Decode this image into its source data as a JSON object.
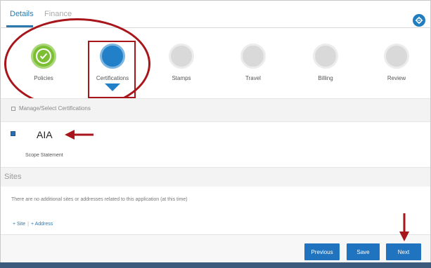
{
  "tabs": {
    "details": "Details",
    "finance": "Finance"
  },
  "steps": [
    {
      "label": "Policies",
      "state": "complete"
    },
    {
      "label": "Certifications",
      "state": "current"
    },
    {
      "label": "Stamps",
      "state": "pending"
    },
    {
      "label": "Travel",
      "state": "pending"
    },
    {
      "label": "Billing",
      "state": "pending"
    },
    {
      "label": "Review",
      "state": "pending"
    }
  ],
  "manage": {
    "label": "Manage/Select Certifications",
    "icon": "grid-icon"
  },
  "certification": {
    "checked": true,
    "title": "AIA",
    "subtitle": "Scope Statement"
  },
  "sites": {
    "heading": "Sites",
    "message": "There are no additional sites or addresses related to this application (at this time)",
    "add_site": "+ Site",
    "separator": "|",
    "add_address": "+ Address"
  },
  "footer": {
    "previous": "Previous",
    "save": "Save",
    "next": "Next"
  },
  "colors": {
    "accent": "#1f73bf",
    "complete": "#7cbf33",
    "pending": "#d9d9d9",
    "annotation": "#a8161b"
  }
}
